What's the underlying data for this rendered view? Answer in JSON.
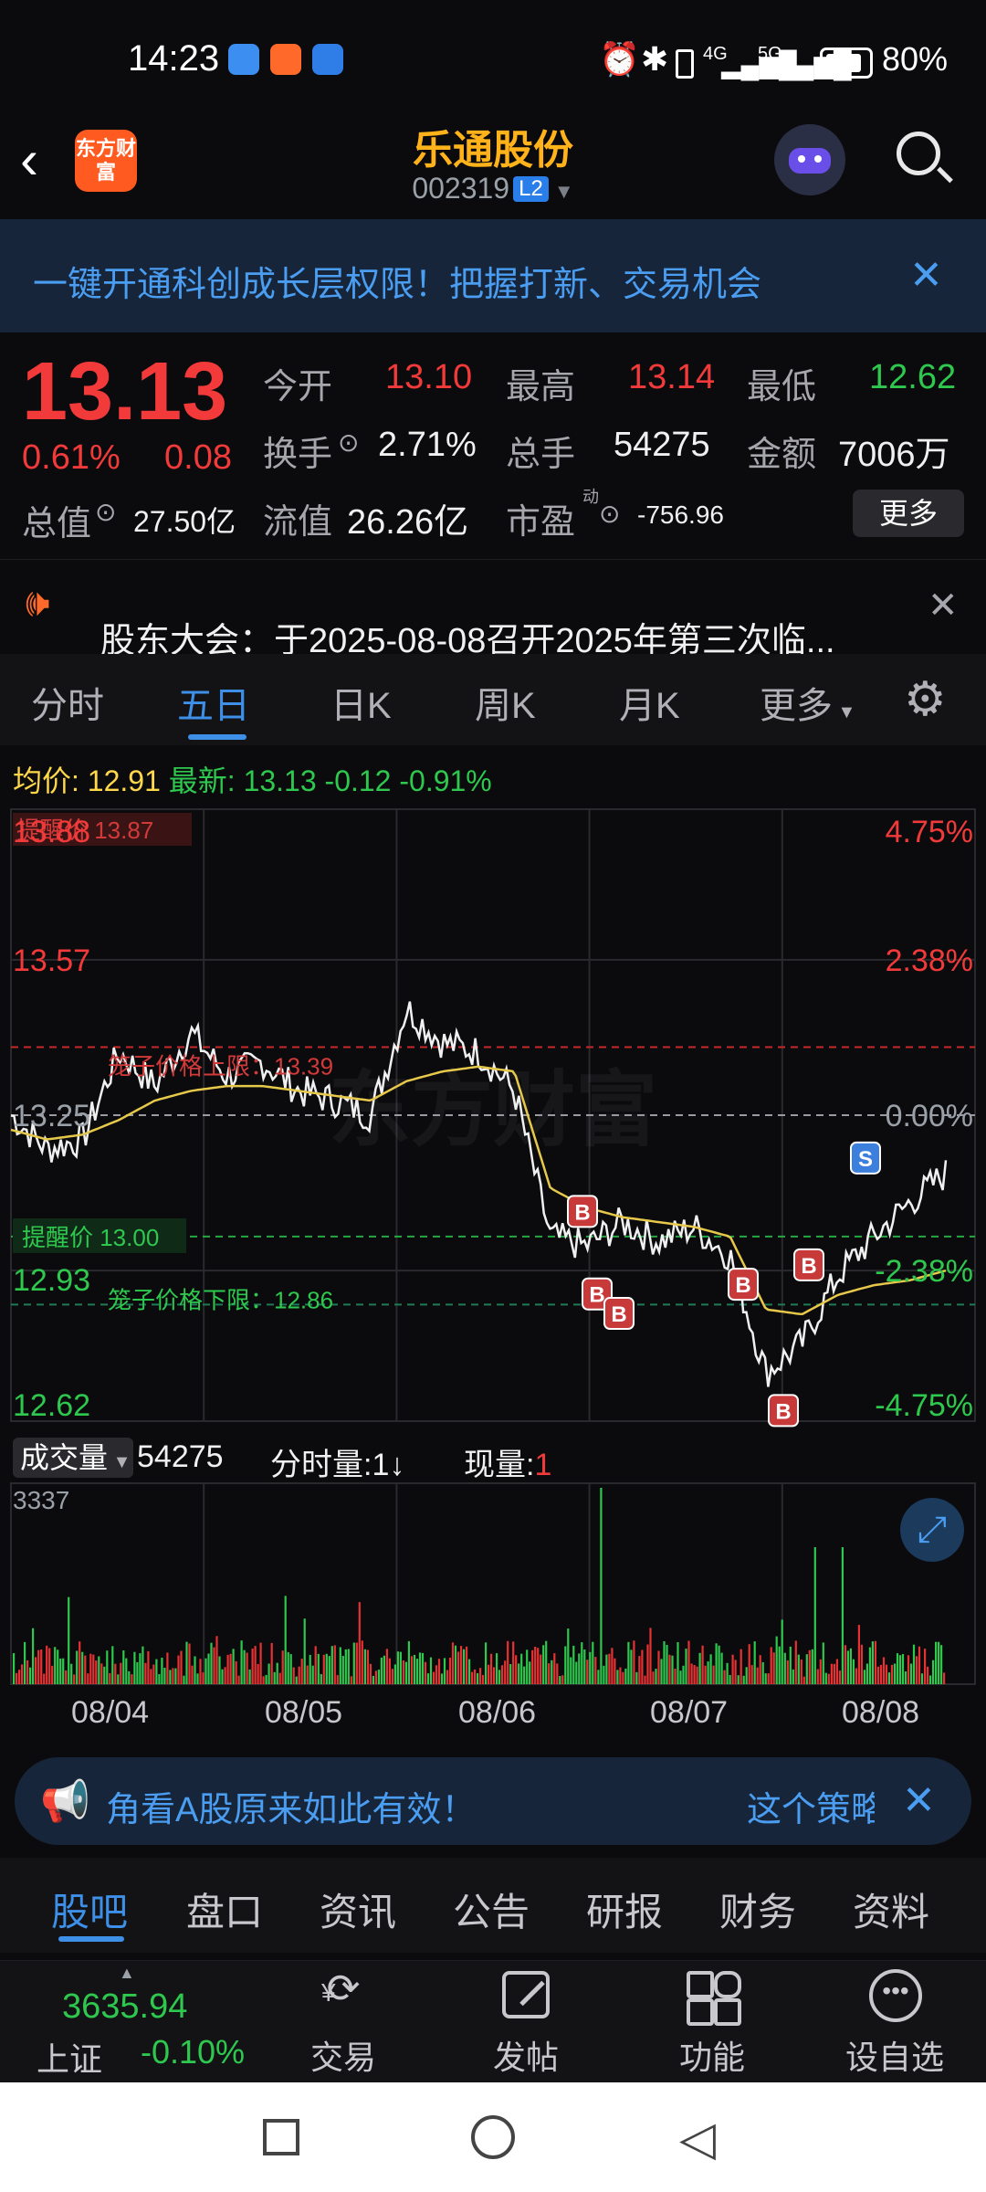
{
  "status_bar": {
    "time": "14:23",
    "battery": "80%",
    "net1": "4G",
    "net2": "5G"
  },
  "header": {
    "logo_text": "东方财富",
    "stock_name": "乐通股份",
    "stock_code": "002319",
    "level_badge": "L2"
  },
  "banner": {
    "text": "一键开通科创成长层权限！把握打新、交易机会"
  },
  "quote": {
    "price": "13.13",
    "change_pct": "0.61%",
    "change_amt": "0.08",
    "total_value_label": "总值",
    "total_value": "27.50亿",
    "open_label": "今开",
    "open": "13.10",
    "high_label": "最高",
    "high": "13.14",
    "low_label": "最低",
    "low": "12.62",
    "turnover_label": "换手",
    "turnover": "2.71%",
    "volume_label": "总手",
    "volume": "54275",
    "amount_label": "金额",
    "amount": "7006万",
    "float_label": "流值",
    "float_value": "26.26亿",
    "pe_label": "市盈",
    "pe_sup": "动",
    "pe": "-756.96",
    "more_button": "更多"
  },
  "notice": {
    "text": "股东大会：于2025-08-08召开2025年第三次临..."
  },
  "chart_tabs": [
    "分时",
    "五日",
    "日K",
    "周K",
    "月K",
    "更多"
  ],
  "chart_header": {
    "avg_label": "均价:",
    "avg_value": "12.91",
    "latest_label": "最新:",
    "latest_value": "13.13",
    "change_amt": "-0.12",
    "change_pct": "-0.91%"
  },
  "chart_labels": {
    "y_top": "13.88",
    "y_2": "13.57",
    "y_mid": "13.25",
    "y_4": "12.93",
    "y_bottom": "12.62",
    "pct_top": "4.75%",
    "pct_2": "2.38%",
    "pct_mid": "0.00%",
    "pct_4": "-2.38%",
    "pct_bottom": "-4.75%",
    "alert_top": "提醒价 13.87",
    "cage_upper": "笼子价格上限：13.39",
    "alert_low": "提醒价 13.00",
    "cage_lower": "笼子价格下限：12.86",
    "watermark": "东方财富",
    "buy_marker": "B",
    "sell_marker": "S"
  },
  "volume": {
    "selector": "成交量",
    "total": "54275",
    "tick_label": "分时量:",
    "tick_value": "1↓",
    "now_label": "现量:",
    "now_value": "1",
    "max_label": "3337"
  },
  "x_axis": [
    "08/04",
    "08/05",
    "08/06",
    "08/07",
    "08/08"
  ],
  "ad": {
    "text": "角看A股原来如此有效！",
    "right_text": "这个策略"
  },
  "bottom_tabs": [
    "股吧",
    "盘口",
    "资讯",
    "公告",
    "研报",
    "财务",
    "资料"
  ],
  "footer": {
    "index_value": "3635.94",
    "index_name": "上证",
    "index_change": "-0.10%",
    "items": [
      "交易",
      "发帖",
      "功能",
      "设自选"
    ]
  },
  "colors": {
    "up": "#f23a3a",
    "down": "#2fc84e",
    "accent": "#3d8fe8",
    "brand": "#ffb21a"
  },
  "chart_data": {
    "type": "line",
    "x": [
      "08/04",
      "08/05",
      "08/06",
      "08/07",
      "08/08"
    ],
    "ylim": [
      12.62,
      13.88
    ],
    "series": [
      {
        "values": [
          13.25,
          13.18,
          13.2,
          13.38,
          13.31,
          13.42,
          13.33,
          13.36,
          13.3,
          13.28,
          13.25,
          13.47,
          13.4,
          13.38,
          13.3,
          13.0,
          12.98,
          13.03,
          12.99,
          13.02,
          12.96,
          12.72,
          12.78,
          12.92,
          13.0,
          13.07,
          13.13
        ]
      },
      {
        "values": [
          13.22,
          13.2,
          13.21,
          13.24,
          13.28,
          13.3,
          13.31,
          13.31,
          13.3,
          13.29,
          13.28,
          13.32,
          13.34,
          13.35,
          13.34,
          13.1,
          13.06,
          13.04,
          13.03,
          13.02,
          13.0,
          12.85,
          12.84,
          12.88,
          12.9,
          12.91,
          12.93
        ]
      }
    ],
    "volume_max": 3337
  }
}
